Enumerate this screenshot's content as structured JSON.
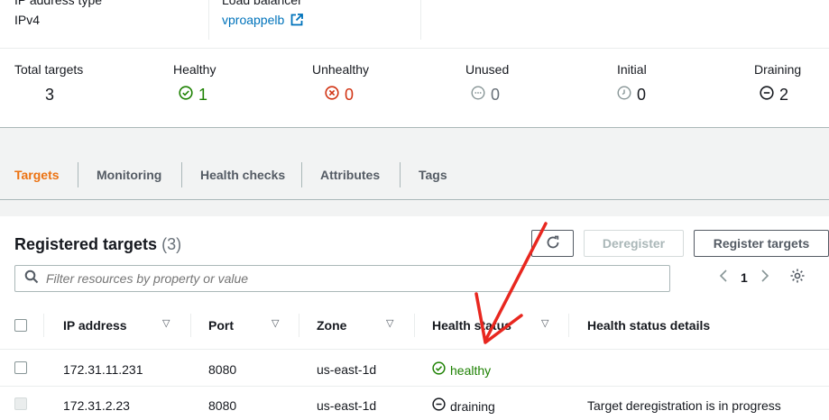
{
  "details": {
    "ip_type_label": "IP address type",
    "ip_type_value": "IPv4",
    "lb_label": "Load balancer",
    "lb_value": "vproappelb"
  },
  "stats": [
    {
      "label": "Total targets",
      "value": "3",
      "icon": "none"
    },
    {
      "label": "Healthy",
      "value": "1",
      "icon": "check-circle-icon",
      "color": "#1d8102"
    },
    {
      "label": "Unhealthy",
      "value": "0",
      "icon": "x-circle-icon",
      "color": "#d13212"
    },
    {
      "label": "Unused",
      "value": "0",
      "icon": "ellipsis-circle-icon",
      "color": "#687078"
    },
    {
      "label": "Initial",
      "value": "0",
      "icon": "clock-icon",
      "color": "#687078"
    },
    {
      "label": "Draining",
      "value": "2",
      "icon": "minus-circle-icon",
      "color": "#16191f"
    }
  ],
  "tabs": [
    {
      "label": "Targets",
      "active": true
    },
    {
      "label": "Monitoring"
    },
    {
      "label": "Health checks"
    },
    {
      "label": "Attributes"
    },
    {
      "label": "Tags"
    }
  ],
  "panel": {
    "title": "Registered targets",
    "count": "(3)",
    "deregister_label": "Deregister",
    "register_label": "Register targets",
    "search_placeholder": "Filter resources by property or value",
    "page": "1"
  },
  "table": {
    "columns": [
      "IP address",
      "Port",
      "Zone",
      "Health status",
      "Health status details"
    ],
    "rows": [
      {
        "ip": "172.31.11.231",
        "port": "8080",
        "zone": "us-east-1d",
        "status": "healthy",
        "status_icon": "check-circle-icon",
        "details": ""
      },
      {
        "ip": "172.31.2.23",
        "port": "8080",
        "zone": "us-east-1d",
        "status": "draining",
        "status_icon": "minus-circle-icon",
        "details": "Target deregistration is in progress"
      }
    ]
  },
  "colors": {
    "accent": "#ec7211",
    "link": "#0073bb",
    "healthy": "#1d8102",
    "unhealthy": "#d13212",
    "annotation": "#e8271f"
  }
}
